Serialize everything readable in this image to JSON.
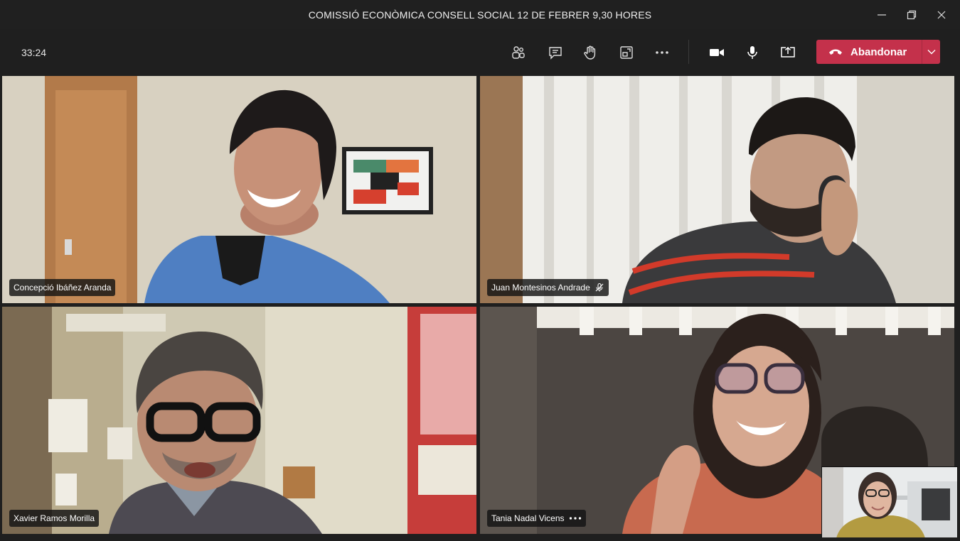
{
  "window": {
    "title": "COMISSIÓ ECONÒMICA CONSELL SOCIAL 12 DE FEBRER 9,30 HORES",
    "controls": [
      "minimize-icon",
      "restore-icon",
      "close-icon"
    ]
  },
  "toolbar": {
    "timer": "33:24",
    "buttons": [
      "participants-icon",
      "chat-icon",
      "raise-hand-icon",
      "rooms-icon",
      "more-options-icon",
      "camera-icon",
      "microphone-icon",
      "share-screen-icon"
    ],
    "leave_label": "Abandonar",
    "leave_color": "#c4314b"
  },
  "participants": [
    {
      "name": "Concepció Ibáñez Aranda"
    },
    {
      "name": "Juan Montesinos Andrade",
      "muted": true
    },
    {
      "name": "Xavier Ramos Morilla"
    },
    {
      "name": "Tania Nadal Vicens",
      "more_icon": "more-options-icon"
    }
  ],
  "colors": {
    "background": "#1f1f1f",
    "titlebar": "#202020"
  }
}
